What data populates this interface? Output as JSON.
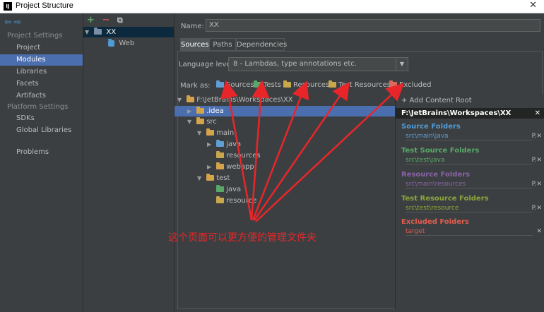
{
  "window": {
    "title": "Project Structure",
    "close": "✕",
    "app_icon": "IJ"
  },
  "nav": {
    "arrows": "⇦⇨",
    "sections": [
      {
        "label": "Project Settings",
        "items": [
          "Project",
          "Modules",
          "Libraries",
          "Facets",
          "Artifacts"
        ]
      },
      {
        "label": "Platform Settings",
        "items": [
          "SDKs",
          "Global Libraries"
        ]
      }
    ],
    "problems": "Problems",
    "selected": "Modules"
  },
  "modules": {
    "add": "+",
    "remove": "−",
    "copy": "⧉",
    "items": [
      {
        "label": "XX",
        "icon": "module-folder-icon",
        "selected": true
      },
      {
        "label": "Web",
        "icon": "web-facet-icon",
        "selected": false
      }
    ]
  },
  "main": {
    "name_label": "Name:",
    "name_value": "XX",
    "tabs": [
      "Sources",
      "Paths",
      "Dependencies"
    ],
    "active_tab": "Sources",
    "language_level_label": "Language level:",
    "language_level_value": "8 - Lambdas, type annotations etc.",
    "mark_as_label": "Mark as:",
    "mark_buttons": [
      {
        "label": "Sources",
        "color": "#5f9fd3"
      },
      {
        "label": "Tests",
        "color": "#59a869"
      },
      {
        "label": "Resources",
        "color": "#c9a84c"
      },
      {
        "label": "Test Resources",
        "color": "#c9a84c"
      },
      {
        "label": "Excluded",
        "color": "#d86b5c"
      }
    ]
  },
  "tree": [
    {
      "label": "F:\\JetBrains\\Workspaces\\XX",
      "expanded": true,
      "color": "#d4a34a"
    },
    {
      "label": ".idea",
      "expanded": false,
      "selected": true,
      "color": "#d4a34a"
    },
    {
      "label": "src",
      "expanded": true,
      "color": "#d4a34a"
    },
    {
      "label": "main",
      "expanded": true,
      "color": "#d4a34a"
    },
    {
      "label": "java",
      "expanded": false,
      "color": "#5f9fd3"
    },
    {
      "label": "resources",
      "color": "#c9a84c"
    },
    {
      "label": "webapp",
      "expanded": false,
      "color": "#d4a34a"
    },
    {
      "label": "test",
      "expanded": true,
      "color": "#d4a34a"
    },
    {
      "label": "java",
      "color": "#59a869"
    },
    {
      "label": "resource",
      "color": "#c9a84c"
    }
  ],
  "content_root": {
    "add_label": "+ Add Content Root",
    "path": "F:\\JetBrains\\Workspaces\\XX",
    "close": "✕",
    "groups": [
      {
        "title": "Source Folders",
        "color": "#4f9bd6",
        "item": "src\\main\\java",
        "item_color": "#5f9fd3",
        "action": "P.✕"
      },
      {
        "title": "Test Source Folders",
        "color": "#59a869",
        "item": "src\\test\\java",
        "item_color": "#59a869",
        "action": "P.✕"
      },
      {
        "title": "Resource Folders",
        "color": "#8a63a8",
        "item": "src\\main\\resources",
        "item_color": "#8a63a8",
        "action": "P.✕"
      },
      {
        "title": "Test Resource Folders",
        "color": "#8ca53a",
        "item": "src\\test\\resource",
        "item_color": "#8ca53a",
        "action": "P.✕"
      },
      {
        "title": "Excluded Folders",
        "color": "#e05c4f",
        "item": "target",
        "item_color": "#e05c4f",
        "action": "✕"
      }
    ]
  },
  "annotation": {
    "text": "这个页面可以更方便的管理文件夹",
    "color": "#e8262a"
  }
}
